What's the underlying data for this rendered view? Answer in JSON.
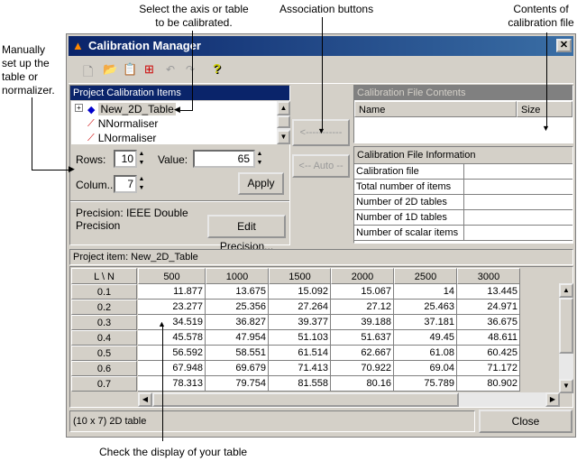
{
  "annotations": {
    "select_axis": [
      "Select the axis or table",
      "to be calibrated."
    ],
    "association": "Association buttons",
    "contents": [
      "Contents of",
      "calibration file"
    ],
    "manual": [
      "Manually",
      "set up the",
      "table or",
      "normalizer."
    ],
    "check": "Check the display of your table"
  },
  "window": {
    "title": "Calibration Manager",
    "close_icon": "close-icon"
  },
  "toolbar": {
    "icons": [
      "new-icon",
      "open-icon",
      "paste-icon",
      "import-icon",
      "undo-icon",
      "redo-icon",
      "help-icon"
    ]
  },
  "project_items": {
    "header": "Project Calibration Items",
    "items": [
      {
        "label": "New_2D_Table",
        "icon": "table-icon",
        "selected": true
      },
      {
        "label": "NNormaliser",
        "icon": "normaliser-icon"
      },
      {
        "label": "LNormaliser",
        "icon": "normaliser-icon"
      }
    ]
  },
  "controls": {
    "rows_label": "Rows:",
    "rows": "10",
    "columns_label": "Colum..",
    "columns": "7",
    "value_label": "Value:",
    "value": "65",
    "apply": "Apply"
  },
  "precision": {
    "text": "Precision: IEEE Double",
    "text2": "Precision",
    "edit": "Edit Precision..."
  },
  "association_buttons": {
    "assign": "<-----------",
    "auto": "<-- Auto --"
  },
  "file_contents": {
    "header": "Calibration File Contents",
    "columns": [
      "Name",
      "Size"
    ]
  },
  "file_info": {
    "header": "Calibration File Information",
    "rows": [
      "Calibration file",
      "Total number of items",
      "Number of 2D tables",
      "Number of 1D tables",
      "Number of scalar items"
    ]
  },
  "table": {
    "label": "Project item: New_2D_Table",
    "corner": "L \\ N",
    "columns": [
      "500",
      "1000",
      "1500",
      "2000",
      "2500",
      "3000"
    ],
    "rows": [
      {
        "h": "0.1",
        "v": [
          "11.877",
          "13.675",
          "15.092",
          "15.067",
          "14",
          "13.445"
        ]
      },
      {
        "h": "0.2",
        "v": [
          "23.277",
          "25.356",
          "27.264",
          "27.12",
          "25.463",
          "24.971"
        ]
      },
      {
        "h": "0.3",
        "v": [
          "34.519",
          "36.827",
          "39.377",
          "39.188",
          "37.181",
          "36.675"
        ]
      },
      {
        "h": "0.4",
        "v": [
          "45.578",
          "47.954",
          "51.103",
          "51.637",
          "49.45",
          "48.611"
        ]
      },
      {
        "h": "0.5",
        "v": [
          "56.592",
          "58.551",
          "61.514",
          "62.667",
          "61.08",
          "60.425"
        ]
      },
      {
        "h": "0.6",
        "v": [
          "67.948",
          "69.679",
          "71.413",
          "70.922",
          "69.04",
          "71.172"
        ]
      },
      {
        "h": "0.7",
        "v": [
          "78.313",
          "79.754",
          "81.558",
          "80.16",
          "75.789",
          "80.902"
        ]
      }
    ]
  },
  "status": {
    "text": "(10 x 7) 2D table",
    "close": "Close"
  }
}
